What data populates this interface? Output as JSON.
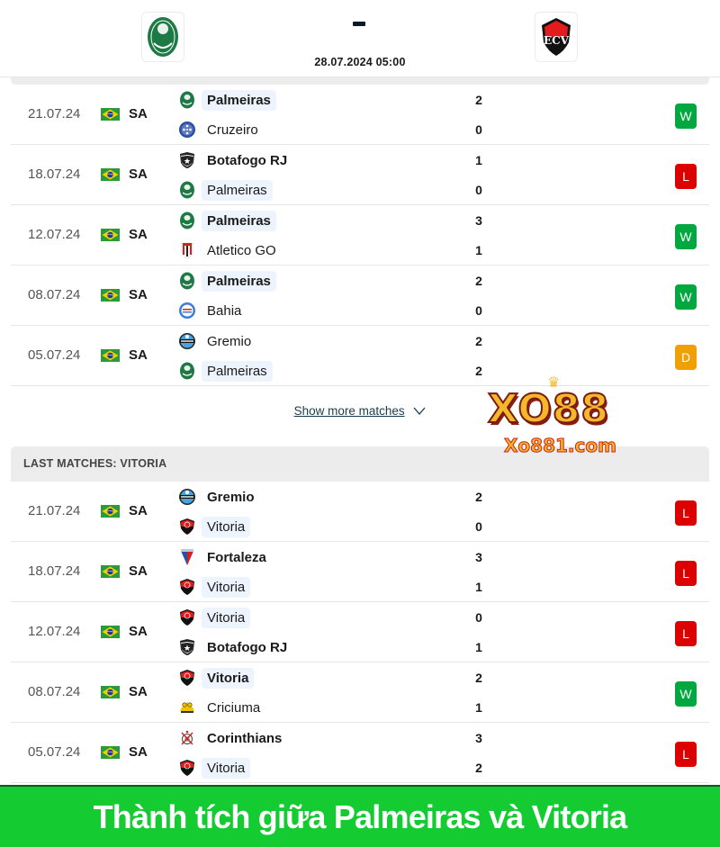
{
  "header": {
    "home_team": "Palmeiras",
    "away_team": "Vitoria",
    "home_crest_icon": "palmeiras-crest-icon",
    "away_crest_icon": "vitoria-crest-icon",
    "score": "-",
    "datetime": "28.07.2024 05:00"
  },
  "colors": {
    "win": "#00a83f",
    "loss": "#dc0000",
    "draw": "#f0a000",
    "highlight": "#edf4fd",
    "banner": "#14cc32"
  },
  "home_matches": [
    {
      "date": "21.07.24",
      "flag": "brazil-flag-icon",
      "competition": "SA",
      "team1": "Palmeiras",
      "team1_logo": "palmeiras",
      "team1_bold": true,
      "team1_hl": true,
      "team2": "Cruzeiro",
      "team2_logo": "cruzeiro",
      "team2_bold": false,
      "team2_hl": false,
      "score1": "2",
      "score2": "0",
      "result": "W"
    },
    {
      "date": "18.07.24",
      "flag": "brazil-flag-icon",
      "competition": "SA",
      "team1": "Botafogo RJ",
      "team1_logo": "botafogo",
      "team1_bold": true,
      "team1_hl": false,
      "team2": "Palmeiras",
      "team2_logo": "palmeiras",
      "team2_bold": false,
      "team2_hl": true,
      "score1": "1",
      "score2": "0",
      "result": "L"
    },
    {
      "date": "12.07.24",
      "flag": "brazil-flag-icon",
      "competition": "SA",
      "team1": "Palmeiras",
      "team1_logo": "palmeiras",
      "team1_bold": true,
      "team1_hl": true,
      "team2": "Atletico GO",
      "team2_logo": "atletico-go",
      "team2_bold": false,
      "team2_hl": false,
      "score1": "3",
      "score2": "1",
      "result": "W"
    },
    {
      "date": "08.07.24",
      "flag": "brazil-flag-icon",
      "competition": "SA",
      "team1": "Palmeiras",
      "team1_logo": "palmeiras",
      "team1_bold": true,
      "team1_hl": true,
      "team2": "Bahia",
      "team2_logo": "bahia",
      "team2_bold": false,
      "team2_hl": false,
      "score1": "2",
      "score2": "0",
      "result": "W"
    },
    {
      "date": "05.07.24",
      "flag": "brazil-flag-icon",
      "competition": "SA",
      "team1": "Gremio",
      "team1_logo": "gremio",
      "team1_bold": false,
      "team1_hl": false,
      "team2": "Palmeiras",
      "team2_logo": "palmeiras",
      "team2_bold": false,
      "team2_hl": true,
      "score1": "2",
      "score2": "2",
      "result": "D"
    }
  ],
  "show_more": {
    "label": "Show more matches",
    "icon": "chevron-down-icon"
  },
  "away_section": {
    "title": "LAST MATCHES: VITORIA"
  },
  "away_matches": [
    {
      "date": "21.07.24",
      "flag": "brazil-flag-icon",
      "competition": "SA",
      "team1": "Gremio",
      "team1_logo": "gremio",
      "team1_bold": true,
      "team1_hl": false,
      "team2": "Vitoria",
      "team2_logo": "vitoria",
      "team2_bold": false,
      "team2_hl": true,
      "score1": "2",
      "score2": "0",
      "result": "L"
    },
    {
      "date": "18.07.24",
      "flag": "brazil-flag-icon",
      "competition": "SA",
      "team1": "Fortaleza",
      "team1_logo": "fortaleza",
      "team1_bold": true,
      "team1_hl": false,
      "team2": "Vitoria",
      "team2_logo": "vitoria",
      "team2_bold": false,
      "team2_hl": true,
      "score1": "3",
      "score2": "1",
      "result": "L"
    },
    {
      "date": "12.07.24",
      "flag": "brazil-flag-icon",
      "competition": "SA",
      "team1": "Vitoria",
      "team1_logo": "vitoria",
      "team1_bold": false,
      "team1_hl": true,
      "team2": "Botafogo RJ",
      "team2_logo": "botafogo",
      "team2_bold": true,
      "team2_hl": false,
      "score1": "0",
      "score2": "1",
      "result": "L"
    },
    {
      "date": "08.07.24",
      "flag": "brazil-flag-icon",
      "competition": "SA",
      "team1": "Vitoria",
      "team1_logo": "vitoria",
      "team1_bold": true,
      "team1_hl": true,
      "team2": "Criciuma",
      "team2_logo": "criciuma",
      "team2_bold": false,
      "team2_hl": false,
      "score1": "2",
      "score2": "1",
      "result": "W"
    },
    {
      "date": "05.07.24",
      "flag": "brazil-flag-icon",
      "competition": "SA",
      "team1": "Corinthians",
      "team1_logo": "corinthians",
      "team1_bold": true,
      "team1_hl": false,
      "team2": "Vitoria",
      "team2_logo": "vitoria",
      "team2_bold": false,
      "team2_hl": true,
      "score1": "3",
      "score2": "2",
      "result": "L"
    }
  ],
  "watermark": {
    "main": "XO88",
    "sub": "Xo881.com"
  },
  "banner": {
    "text": "Thành tích giữa Palmeiras và Vitoria"
  }
}
